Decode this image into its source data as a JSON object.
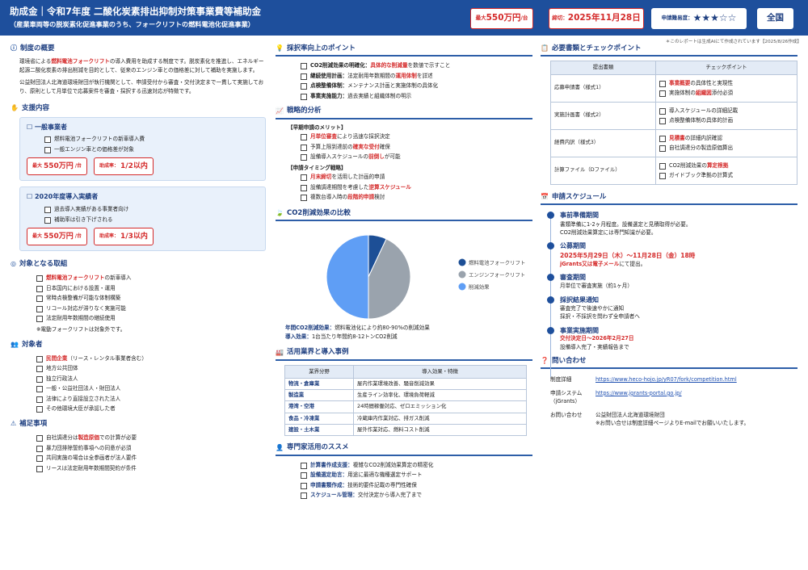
{
  "header": {
    "title": "助成金｜令和7年度 二酸化炭素排出抑制対策事業費等補助金",
    "subtitle": "（産業車両等の脱炭素化促進事業のうち、フォークリフトの燃料電池化促進事業）",
    "max_small": "最大",
    "max_big": "550万円",
    "max_unit": "/台",
    "deadline_small": "締切：",
    "deadline_big": "2025年11月28日",
    "difficulty_label": "申請難易度：",
    "difficulty_stars": "★★★☆☆",
    "region": "全国"
  },
  "note": "＊このレポートは生成AIにて作成されています【2025/8/26作成】",
  "overview": {
    "title": "制度の概要",
    "p1a": "環境省による",
    "p1b": "燃料電池フォークリフト",
    "p1c": "の導入費用を助成する制度です。脱炭素化を推進し、エネルギー起源二酸化炭素の排出削減を目的として、従来のエンジン車との価格差に対して補助を実施します。",
    "p2": "公益財団法人北海道環境財団が執行機関として、申請受付から審査・交付決定まで一貫して実施しており、原則として月単位で応募案件を審査・採択する迅速対応が特徴です。"
  },
  "support": {
    "title": "支援内容",
    "general": {
      "title": "☐ 一般事業者",
      "items": [
        "燃料電池フォークリフトの新車導入費",
        "一般エンジン車との価格差が対象"
      ],
      "max_small": "最大",
      "max_big": "550万円",
      "max_unit": "/台",
      "rate_small": "助成率：",
      "rate_big": "1/2以内"
    },
    "y2020": {
      "title": "☐ 2020年度導入実績者",
      "items": [
        "過去導入実績がある事業者向け",
        "補助率は引き下げされる"
      ],
      "max_small": "最大",
      "max_big": "550万円",
      "max_unit": "/台",
      "rate_small": "助成率：",
      "rate_big": "1/3以内"
    }
  },
  "targets": {
    "title": "対象となる取組",
    "items": [
      {
        "pre": "",
        "red": "燃料電池フォークリフト",
        "post": "の新車導入"
      },
      {
        "pre": "日本国内における設置・運用",
        "red": "",
        "post": ""
      },
      {
        "pre": "常時点検整備が可能な体制構築",
        "red": "",
        "post": ""
      },
      {
        "pre": "リコール対応が滞りなく実施可能",
        "red": "",
        "post": ""
      },
      {
        "pre": "法定耐用年数期間の継続使用",
        "red": "",
        "post": ""
      }
    ],
    "note": "※電動フォークリフトは対象外です。"
  },
  "applicants": {
    "title": "対象者",
    "items": [
      {
        "red": "民間企業",
        "post": "（リース・レンタル事業者含む）"
      },
      {
        "red": "",
        "post": "地方公共団体"
      },
      {
        "red": "",
        "post": "独立行政法人"
      },
      {
        "red": "",
        "post": "一般・公益社団法人・財団法人"
      },
      {
        "red": "",
        "post": "法律により直接設立された法人"
      },
      {
        "red": "",
        "post": "その他環境大臣が承認した者"
      }
    ]
  },
  "supplement": {
    "title": "補足事項",
    "items": [
      {
        "pre": "自社調達分は",
        "red": "製造原価",
        "post": "での計算が必要"
      },
      {
        "pre": "暴力団排除誓約事項への同意が必須",
        "red": "",
        "post": ""
      },
      {
        "pre": "共同実施の場合は全参画者が法人要件",
        "red": "",
        "post": ""
      },
      {
        "pre": "リースは法定耐用年数期間契約が条件",
        "red": "",
        "post": ""
      }
    ]
  },
  "points": {
    "title": "採択率向上のポイント",
    "items": [
      {
        "b": "CO2削減効果の明確化：",
        "red": "具体的な削減量",
        "post": "を数値で示すこと"
      },
      {
        "b": "継続使用計画：",
        "red": "",
        "pre": "法定耐用年数期間の",
        "red2": "運用体制",
        "post": "を詳述"
      },
      {
        "b": "点検整備体制：",
        "post": "メンテナンス計画と実施体制の具体化"
      },
      {
        "b": "事業実施能力：",
        "post": "過去実績と組織体制の明示"
      }
    ]
  },
  "strategy": {
    "title": "戦略的分析",
    "m_title": "【早期申請のメリット】",
    "m_items": [
      {
        "red": "月単位審査",
        "post": "により迅速な採択決定"
      },
      {
        "pre": "予算上限到達前の",
        "red": "確実な受付",
        "post": "確保"
      },
      {
        "pre": "設備導入スケジュールの",
        "red": "前倒し",
        "post": "が可能"
      }
    ],
    "t_title": "【申請タイミング戦略】",
    "t_items": [
      {
        "red": "月末締切",
        "post": "を活用した計画的申請"
      },
      {
        "pre": "設備調達期間を考慮した",
        "red": "逆算スケジュール",
        "post": ""
      },
      {
        "pre": "複数台導入時の",
        "red": "段階的申請",
        "post": "検討"
      }
    ]
  },
  "co2": {
    "title": "CO2削減効果の比較",
    "legend": [
      "燃料電池フォークリフト",
      "エンジンフォークリフト",
      "削減効果"
    ],
    "annual_label": "年間CO2削減効果：",
    "annual_text": "燃料電池化により約80-90%の削減効果",
    "intro_label": "導入効果：",
    "intro_text": "1台当たり年間約8-12トンCO2削減",
    "colors": [
      "#1d4f96",
      "#9aa3ad",
      "#5f9ef5"
    ]
  },
  "chart_data": {
    "type": "pie",
    "labels": [
      "燃料電池フォークリフト",
      "エンジンフォークリフト",
      "削減効果"
    ],
    "values": [
      7,
      43,
      50
    ]
  },
  "industries": {
    "title": "活用業界と導入事例",
    "headers": [
      "業界分野",
      "導入効果・特徴"
    ],
    "rows": [
      [
        "物流・倉庫業",
        "屋内作業環境改善、騒音削減効果"
      ],
      [
        "製造業",
        "生産ライン効率化、環境負荷軽減"
      ],
      [
        "港湾・空港",
        "24時間稼働対応、ゼロエミッション化"
      ],
      [
        "食品・冷凍業",
        "冷蔵庫内作業対応、排ガス削減"
      ],
      [
        "建設・土木業",
        "屋外作業対応、燃料コスト削減"
      ]
    ]
  },
  "experts": {
    "title": "専門家活用のススメ",
    "items": [
      {
        "b": "計算書作成支援：",
        "post": "複雑なCO2削減効果算定の精密化"
      },
      {
        "b": "設備選定助言：",
        "post": "用途に最適な機種選定サポート"
      },
      {
        "b": "申請書類作成：",
        "post": "技術的要件記載の専門性確保"
      },
      {
        "b": "スケジュール管理：",
        "post": "交付決定から導入完了まで"
      }
    ]
  },
  "docs": {
    "title": "必要書類とチェックポイント",
    "headers": [
      "提出書類",
      "チェックポイント"
    ],
    "rows": [
      {
        "name": "応募申請書（様式1）",
        "checks": [
          {
            "red": "事業概要",
            "post": "の具体性と実現性"
          },
          {
            "pre": "実施体制の",
            "red": "組織図",
            "post": "添付必須"
          }
        ]
      },
      {
        "name": "実施計画書（様式2）",
        "checks": [
          {
            "pre": "導入スケジュールの詳細記載"
          },
          {
            "pre": "点検整備体制の具体的計画"
          }
        ]
      },
      {
        "name": "経費内訳（様式3）",
        "checks": [
          {
            "red": "見積書",
            "post": "の詳細内訳確認"
          },
          {
            "pre": "自社調達分の製造原価算出"
          }
        ]
      },
      {
        "name": "計算ファイル（Dファイル）",
        "checks": [
          {
            "pre": "CO2削減効果の",
            "red": "算定根拠",
            "post": ""
          },
          {
            "pre": "ガイドブック準拠の計算式"
          }
        ]
      }
    ]
  },
  "schedule": {
    "title": "申請スケジュール",
    "items": [
      {
        "h": "事前準備期間",
        "lines": [
          "書類準備に1-2ヶ月程度。設備選定と見積取得が必要。",
          "CO2削減効果算定には専門知識が必要。"
        ]
      },
      {
        "h": "公募期間",
        "red1": "2025年5月29日（木）〜11月28日（金）18時",
        "red2": "jGrants又は電子メール",
        "post2": "にて提出。"
      },
      {
        "h": "審査期間",
        "lines": [
          "月単位で審査実施（約1ヶ月）"
        ]
      },
      {
        "h": "採択結果通知",
        "lines": [
          "審査完了で後速やかに通知",
          "採択・不採択を問わず全申請者へ"
        ]
      },
      {
        "h": "事業実施期間",
        "red1": "交付決定日〜2026年2月27日",
        "lines": [
          "設備導入完了・実績報告まで"
        ]
      }
    ]
  },
  "contact": {
    "title": "問い合わせ",
    "rows": [
      {
        "label": "制度詳細",
        "value": "https://www.heco-hojo.jp/yR07/fork/competition.html",
        "link": true
      },
      {
        "label": "申請システム（jGrants）",
        "value": "https://www.jgrants-portal.go.jp/",
        "link": true
      },
      {
        "label": "お問い合わせ",
        "value": "公益財団法人北海道環境財団",
        "value2": "※お問い合せは制度詳細ページよりE-mailでお願いいたします。",
        "link": false
      }
    ]
  }
}
